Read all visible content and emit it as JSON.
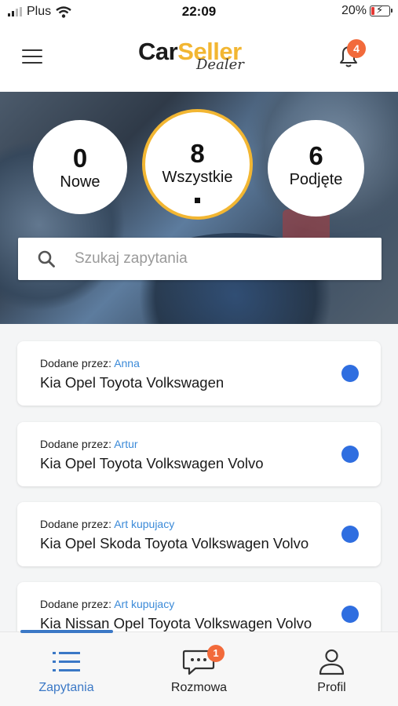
{
  "status_bar": {
    "carrier": "Plus",
    "time": "22:09",
    "battery_percent": "20%",
    "battery_level": 0.2,
    "battery_color": "#e53935"
  },
  "header": {
    "logo_car": "Car",
    "logo_seller": "Seller",
    "logo_dealer": "Dealer",
    "menu_icon": "hamburger-menu-icon",
    "bell_icon": "bell-icon",
    "notification_count": "4",
    "accent_color": "#f2b632",
    "badge_color": "#f26a3b"
  },
  "stats": {
    "new": {
      "count": "0",
      "label": "Nowe"
    },
    "all": {
      "count": "8",
      "label": "Wszystkie"
    },
    "taken": {
      "count": "6",
      "label": "Podjęte"
    },
    "selected": "all"
  },
  "search": {
    "placeholder": "Szukaj zapytania",
    "value": "",
    "icon": "search-icon"
  },
  "inquiries": {
    "added_by_label": "Dodane przez:",
    "unread_dot_color": "#2f6ee0",
    "author_color": "#3b8ad8",
    "items": [
      {
        "author": "Anna",
        "cars": "Kia Opel Toyota Volkswagen"
      },
      {
        "author": "Artur",
        "cars": "Kia Opel Toyota Volkswagen Volvo"
      },
      {
        "author": "Art kupujacy",
        "cars": "Kia Opel Skoda Toyota Volkswagen Volvo"
      },
      {
        "author": "Art kupujacy",
        "cars": "Kia Nissan Opel Toyota Volkswagen Volvo"
      }
    ]
  },
  "bottom_nav": {
    "items": [
      {
        "label": "Zapytania",
        "icon": "list-icon",
        "active": true
      },
      {
        "label": "Rozmowa",
        "icon": "chat-icon",
        "badge": "1"
      },
      {
        "label": "Profil",
        "icon": "user-icon"
      }
    ],
    "active_color": "#3b78c6"
  }
}
